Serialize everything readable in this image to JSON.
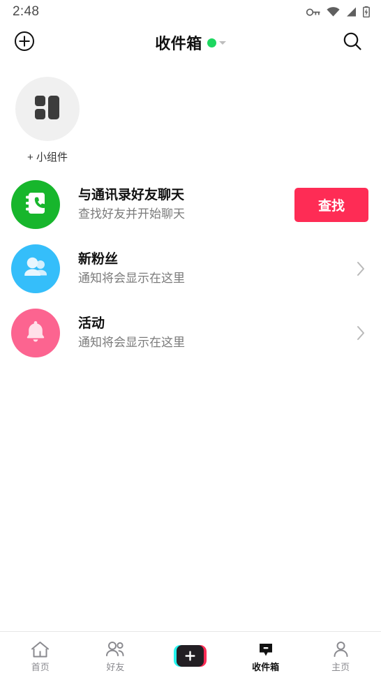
{
  "status_bar": {
    "time": "2:48",
    "icons": [
      "vpn-key-icon",
      "wifi-icon",
      "cellular-signal-icon",
      "battery-charging-icon"
    ]
  },
  "header": {
    "add_icon": "plus-circle-icon",
    "title": "收件箱",
    "presence_dot_color": "#1ed760",
    "presence_caret_icon": "chevron-down-icon",
    "search_icon": "search-icon"
  },
  "widget": {
    "icon": "widget-grid-icon",
    "label": "+ 小组件",
    "circle_color": "#f0f0f0"
  },
  "list": [
    {
      "id": "contacts-chat",
      "icon": "contact-book-phone-icon",
      "avatar_color": "#17b62c",
      "title": "与通讯录好友聊天",
      "subtitle": "查找好友并开始聊天",
      "action_type": "button",
      "action_label": "查找",
      "action_color": "#fe2c55"
    },
    {
      "id": "new-followers",
      "icon": "two-people-icon",
      "avatar_color": "#35befa",
      "title": "新粉丝",
      "subtitle": "通知将会显示在这里",
      "action_type": "chevron",
      "action_label": "",
      "action_color": ""
    },
    {
      "id": "activity",
      "icon": "bell-icon",
      "avatar_color": "#fc6490",
      "title": "活动",
      "subtitle": "通知将会显示在这里",
      "action_type": "chevron",
      "action_label": "",
      "action_color": ""
    }
  ],
  "bottom_nav": {
    "items": [
      {
        "id": "home",
        "icon": "home-icon",
        "label": "首页",
        "active": false
      },
      {
        "id": "friends",
        "icon": "friends-icon",
        "label": "好友",
        "active": false
      },
      {
        "id": "create",
        "icon": "plus-create-icon",
        "label": "",
        "active": false
      },
      {
        "id": "inbox",
        "icon": "inbox-message-icon",
        "label": "收件箱",
        "active": true
      },
      {
        "id": "profile",
        "icon": "profile-person-icon",
        "label": "主页",
        "active": false
      }
    ],
    "create_colors": {
      "cyan": "#25f4ee",
      "pink": "#fe2c55",
      "core": "#231f24"
    }
  }
}
